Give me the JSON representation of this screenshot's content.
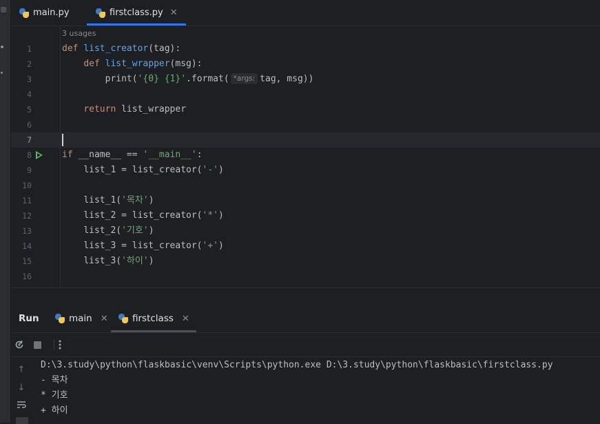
{
  "tabs": [
    {
      "label": "main.py",
      "active": false,
      "closable": false
    },
    {
      "label": "firstclass.py",
      "active": true,
      "closable": true
    }
  ],
  "editor": {
    "usages": "3 usages",
    "line_numbers": [
      "1",
      "2",
      "3",
      "4",
      "5",
      "6",
      "7",
      "8",
      "9",
      "10",
      "11",
      "12",
      "13",
      "14",
      "15",
      "16"
    ],
    "current_line": "7",
    "param_hint": "*args:",
    "lines": {
      "l1": {
        "kw": "def",
        "fn": "list_creator",
        "rest": "(tag):"
      },
      "l2": {
        "indent": "    ",
        "kw": "def",
        "fn": "list_wrapper",
        "rest": "(msg):"
      },
      "l3": {
        "indent": "        ",
        "pre": "print(",
        "str": "'{0} {1}'",
        "mid": ".format(",
        "post": "tag, msg))"
      },
      "l5": {
        "indent": "    ",
        "kw": "return",
        "rest": " list_wrapper"
      },
      "l8": {
        "kw": "if",
        "mid": " __name__ == ",
        "str": "'__main__'",
        "post": ":"
      },
      "l9": {
        "indent": "    ",
        "pre": "list_1 = list_creator(",
        "str": "'-'",
        "post": ")"
      },
      "l11": {
        "indent": "    ",
        "pre": "list_1(",
        "str": "'목차'",
        "post": ")"
      },
      "l12": {
        "indent": "    ",
        "pre": "list_2 = list_creator(",
        "str": "'*'",
        "post": ")"
      },
      "l13": {
        "indent": "    ",
        "pre": "list_2(",
        "str": "'기호'",
        "post": ")"
      },
      "l14": {
        "indent": "    ",
        "pre": "list_3 = list_creator(",
        "str": "'+'",
        "post": ")"
      },
      "l15": {
        "indent": "    ",
        "pre": "list_3(",
        "str": "'하이'",
        "post": ")"
      }
    }
  },
  "run_panel": {
    "title": "Run",
    "tabs": [
      {
        "label": "main",
        "active": false
      },
      {
        "label": "firstclass",
        "active": true
      }
    ],
    "output": [
      "D:\\3.study\\python\\flaskbasic\\venv\\Scripts\\python.exe D:\\3.study\\python\\flaskbasic\\firstclass.py",
      "- 목차",
      "* 기호",
      "+ 하이"
    ]
  },
  "icons": {
    "file": "python-file-icon",
    "rerun": "rerun-icon",
    "stop": "stop-icon",
    "more": "more-vertical-icon",
    "up": "arrow-up-icon",
    "down": "arrow-down-icon",
    "wrap": "soft-wrap-icon",
    "run_gutter": "run-gutter-icon"
  },
  "colors": {
    "keyword": "#cf8e6d",
    "function": "#56a8f5",
    "string": "#6aab73",
    "accent": "#3574f0",
    "run_green": "#5fb865"
  }
}
